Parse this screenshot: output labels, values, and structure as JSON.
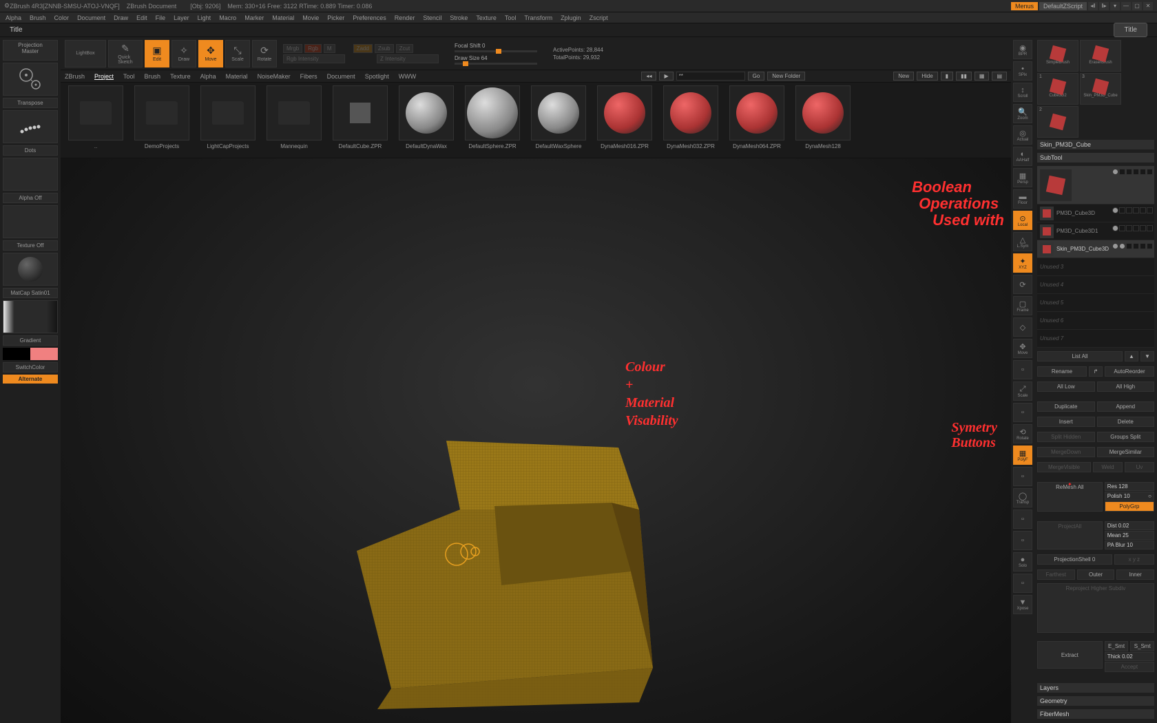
{
  "top": {
    "app": "ZBrush 4R3[ZNNB-SMSU-ATOJ-VNQF]",
    "doc": "ZBrush Document",
    "obj": "[Obj: 9206]",
    "mem": "Mem: 330+16",
    "free": "Free: 3122",
    "rtime": "RTime: 0.889",
    "timer": "Timer: 0.086",
    "menus": "Menus",
    "script": "DefaultZScript"
  },
  "menus": [
    "Alpha",
    "Brush",
    "Color",
    "Document",
    "Draw",
    "Edit",
    "File",
    "Layer",
    "Light",
    "Macro",
    "Marker",
    "Material",
    "Movie",
    "Picker",
    "Preferences",
    "Render",
    "Stencil",
    "Stroke",
    "Texture",
    "Tool",
    "Transform",
    "Zplugin",
    "Zscript"
  ],
  "title": "Title",
  "title2": "Title",
  "toolbar": {
    "projection": "Projection\nMaster",
    "lightbox": "LightBox",
    "quicksketch": "Quick\nSketch",
    "edit": "Edit",
    "draw": "Draw",
    "move": "Move",
    "scale": "Scale",
    "rotate": "Rotate",
    "mrgb": "Mrgb",
    "rgb": "Rgb",
    "m": "M",
    "zadd": "Zadd",
    "zsub": "Zsub",
    "zcut": "Zcut",
    "rgbint": "Rgb Intensity",
    "zint": "Z Intensity",
    "focal": "Focal Shift 0",
    "drawsize": "Draw Size 64",
    "activepoints": "ActivePoints: 28,844",
    "totalpoints": "TotalPoints: 29,932"
  },
  "tabs": [
    "ZBrush",
    "Project",
    "Tool",
    "Brush",
    "Texture",
    "Alpha",
    "Material",
    "NoiseMaker",
    "Fibers",
    "Document",
    "Spotlight",
    "WWW"
  ],
  "tabbar": {
    "go": "Go",
    "newfolder": "New Folder",
    "search": "**",
    "new": "New",
    "hide": "Hide"
  },
  "browser": [
    {
      "name": ".."
    },
    {
      "name": "DemoProjects"
    },
    {
      "name": "LightCapProjects"
    },
    {
      "name": "Mannequin"
    },
    {
      "name": "DefaultCube.ZPR"
    },
    {
      "name": "DefaultDynaWax"
    },
    {
      "name": "DefaultSphere.ZPR"
    },
    {
      "name": "DefaultWaxSphere"
    },
    {
      "name": "DynaMesh016.ZPR"
    },
    {
      "name": "DynaMesh032.ZPR"
    },
    {
      "name": "DynaMesh064.ZPR"
    },
    {
      "name": "DynaMesh128"
    }
  ],
  "left": {
    "transpose": "Transpose",
    "dots": "Dots",
    "alphaoff": "Alpha Off",
    "textureoff": "Texture Off",
    "matcap": "MatCap Satin01",
    "gradient": "Gradient",
    "switchcolor": "SwitchColor",
    "alternate": "Alternate"
  },
  "rtools": [
    "BPR",
    "SPix",
    "Scroll",
    "Zoom",
    "Actual",
    "AAHalf",
    "Persp",
    "Floor",
    "Local",
    "L.Sym",
    "XYZ",
    "",
    "Frame",
    "",
    "Move",
    "",
    "Scale",
    "",
    "Rotate",
    "PolyF",
    "",
    "Transp",
    "",
    "",
    "Solo",
    "",
    "Xpose"
  ],
  "right": {
    "brushes": [
      {
        "n": "",
        "name": "SimpleBrush"
      },
      {
        "n": "",
        "name": "EraserBrush"
      },
      {
        "n": "1",
        "name": "Cube3D2"
      },
      {
        "n": "3",
        "name": "Skin_PM3D_Cube"
      },
      {
        "n": "2",
        "name": ""
      }
    ],
    "activetool": "Skin_PM3D_Cube",
    "subtool_hdr": "SubTool",
    "subtools": [
      "PM3D_Cube3D",
      "PM3D_Cube3D1",
      "Skin_PM3D_Cube3D"
    ],
    "unused": [
      "Unused 3",
      "Unused 4",
      "Unused 5",
      "Unused 6",
      "Unused 7"
    ],
    "buttons": {
      "listall": "List All",
      "rename": "Rename",
      "autoreorder": "AutoReorder",
      "alllow": "All Low",
      "allhigh": "All High",
      "duplicate": "Duplicate",
      "append": "Append",
      "insert": "Insert",
      "delete": "Delete",
      "splithidden": "Split Hidden",
      "groupssplit": "Groups Split",
      "mergedown": "MergeDown",
      "mergesimilar": "MergeSimilar",
      "mergevisible": "MergeVisible",
      "weld": "Weld",
      "uv": "Uv",
      "remeshall": "ReMesh All",
      "res": "Res 128",
      "polish": "Polish 10",
      "polygrp": "PolyGrp",
      "projectall": "ProjectAll",
      "dist": "Dist 0.02",
      "mean": "Mean 25",
      "pablur": "PA Blur 10",
      "projshell": "ProjectionShell 0",
      "xyz": "x y z",
      "farthest": "Farthest",
      "outer": "Outer",
      "inner": "Inner",
      "reproject": "Reproject Higher Subdiv",
      "extract": "Extract",
      "esmt": "E_Smt",
      "ssmt": "S_Smt",
      "thick": "Thick 0.02",
      "accept": "Accept",
      "layers": "Layers",
      "geometry": "Geometry",
      "fibermesh": "FiberMesh"
    }
  },
  "annotations": {
    "bool1": "Boolean",
    "bool2": "Operations",
    "bool3": "Used with",
    "colour": "Colour\n+\nMaterial\nVisability",
    "sym": "Symetry\nButtons"
  }
}
